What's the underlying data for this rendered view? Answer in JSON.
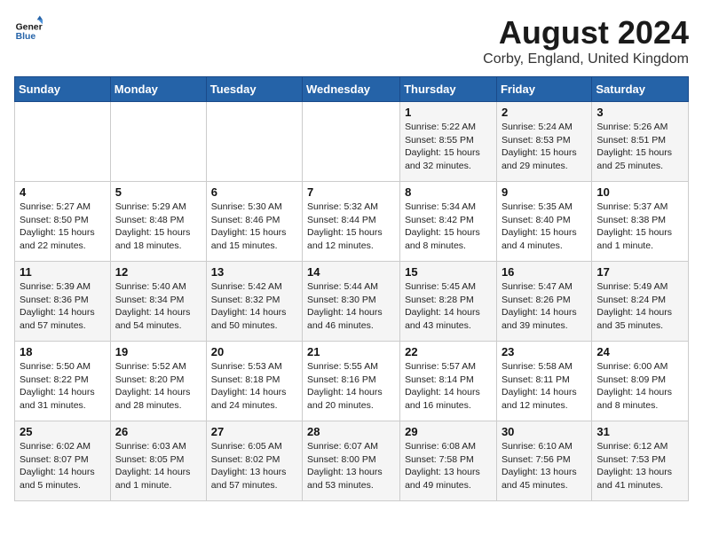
{
  "header": {
    "logo_line1": "General",
    "logo_line2": "Blue",
    "month": "August 2024",
    "location": "Corby, England, United Kingdom"
  },
  "days_of_week": [
    "Sunday",
    "Monday",
    "Tuesday",
    "Wednesday",
    "Thursday",
    "Friday",
    "Saturday"
  ],
  "weeks": [
    [
      {
        "day": "",
        "info": ""
      },
      {
        "day": "",
        "info": ""
      },
      {
        "day": "",
        "info": ""
      },
      {
        "day": "",
        "info": ""
      },
      {
        "day": "1",
        "info": "Sunrise: 5:22 AM\nSunset: 8:55 PM\nDaylight: 15 hours\nand 32 minutes."
      },
      {
        "day": "2",
        "info": "Sunrise: 5:24 AM\nSunset: 8:53 PM\nDaylight: 15 hours\nand 29 minutes."
      },
      {
        "day": "3",
        "info": "Sunrise: 5:26 AM\nSunset: 8:51 PM\nDaylight: 15 hours\nand 25 minutes."
      }
    ],
    [
      {
        "day": "4",
        "info": "Sunrise: 5:27 AM\nSunset: 8:50 PM\nDaylight: 15 hours\nand 22 minutes."
      },
      {
        "day": "5",
        "info": "Sunrise: 5:29 AM\nSunset: 8:48 PM\nDaylight: 15 hours\nand 18 minutes."
      },
      {
        "day": "6",
        "info": "Sunrise: 5:30 AM\nSunset: 8:46 PM\nDaylight: 15 hours\nand 15 minutes."
      },
      {
        "day": "7",
        "info": "Sunrise: 5:32 AM\nSunset: 8:44 PM\nDaylight: 15 hours\nand 12 minutes."
      },
      {
        "day": "8",
        "info": "Sunrise: 5:34 AM\nSunset: 8:42 PM\nDaylight: 15 hours\nand 8 minutes."
      },
      {
        "day": "9",
        "info": "Sunrise: 5:35 AM\nSunset: 8:40 PM\nDaylight: 15 hours\nand 4 minutes."
      },
      {
        "day": "10",
        "info": "Sunrise: 5:37 AM\nSunset: 8:38 PM\nDaylight: 15 hours\nand 1 minute."
      }
    ],
    [
      {
        "day": "11",
        "info": "Sunrise: 5:39 AM\nSunset: 8:36 PM\nDaylight: 14 hours\nand 57 minutes."
      },
      {
        "day": "12",
        "info": "Sunrise: 5:40 AM\nSunset: 8:34 PM\nDaylight: 14 hours\nand 54 minutes."
      },
      {
        "day": "13",
        "info": "Sunrise: 5:42 AM\nSunset: 8:32 PM\nDaylight: 14 hours\nand 50 minutes."
      },
      {
        "day": "14",
        "info": "Sunrise: 5:44 AM\nSunset: 8:30 PM\nDaylight: 14 hours\nand 46 minutes."
      },
      {
        "day": "15",
        "info": "Sunrise: 5:45 AM\nSunset: 8:28 PM\nDaylight: 14 hours\nand 43 minutes."
      },
      {
        "day": "16",
        "info": "Sunrise: 5:47 AM\nSunset: 8:26 PM\nDaylight: 14 hours\nand 39 minutes."
      },
      {
        "day": "17",
        "info": "Sunrise: 5:49 AM\nSunset: 8:24 PM\nDaylight: 14 hours\nand 35 minutes."
      }
    ],
    [
      {
        "day": "18",
        "info": "Sunrise: 5:50 AM\nSunset: 8:22 PM\nDaylight: 14 hours\nand 31 minutes."
      },
      {
        "day": "19",
        "info": "Sunrise: 5:52 AM\nSunset: 8:20 PM\nDaylight: 14 hours\nand 28 minutes."
      },
      {
        "day": "20",
        "info": "Sunrise: 5:53 AM\nSunset: 8:18 PM\nDaylight: 14 hours\nand 24 minutes."
      },
      {
        "day": "21",
        "info": "Sunrise: 5:55 AM\nSunset: 8:16 PM\nDaylight: 14 hours\nand 20 minutes."
      },
      {
        "day": "22",
        "info": "Sunrise: 5:57 AM\nSunset: 8:14 PM\nDaylight: 14 hours\nand 16 minutes."
      },
      {
        "day": "23",
        "info": "Sunrise: 5:58 AM\nSunset: 8:11 PM\nDaylight: 14 hours\nand 12 minutes."
      },
      {
        "day": "24",
        "info": "Sunrise: 6:00 AM\nSunset: 8:09 PM\nDaylight: 14 hours\nand 8 minutes."
      }
    ],
    [
      {
        "day": "25",
        "info": "Sunrise: 6:02 AM\nSunset: 8:07 PM\nDaylight: 14 hours\nand 5 minutes."
      },
      {
        "day": "26",
        "info": "Sunrise: 6:03 AM\nSunset: 8:05 PM\nDaylight: 14 hours\nand 1 minute."
      },
      {
        "day": "27",
        "info": "Sunrise: 6:05 AM\nSunset: 8:02 PM\nDaylight: 13 hours\nand 57 minutes."
      },
      {
        "day": "28",
        "info": "Sunrise: 6:07 AM\nSunset: 8:00 PM\nDaylight: 13 hours\nand 53 minutes."
      },
      {
        "day": "29",
        "info": "Sunrise: 6:08 AM\nSunset: 7:58 PM\nDaylight: 13 hours\nand 49 minutes."
      },
      {
        "day": "30",
        "info": "Sunrise: 6:10 AM\nSunset: 7:56 PM\nDaylight: 13 hours\nand 45 minutes."
      },
      {
        "day": "31",
        "info": "Sunrise: 6:12 AM\nSunset: 7:53 PM\nDaylight: 13 hours\nand 41 minutes."
      }
    ]
  ]
}
